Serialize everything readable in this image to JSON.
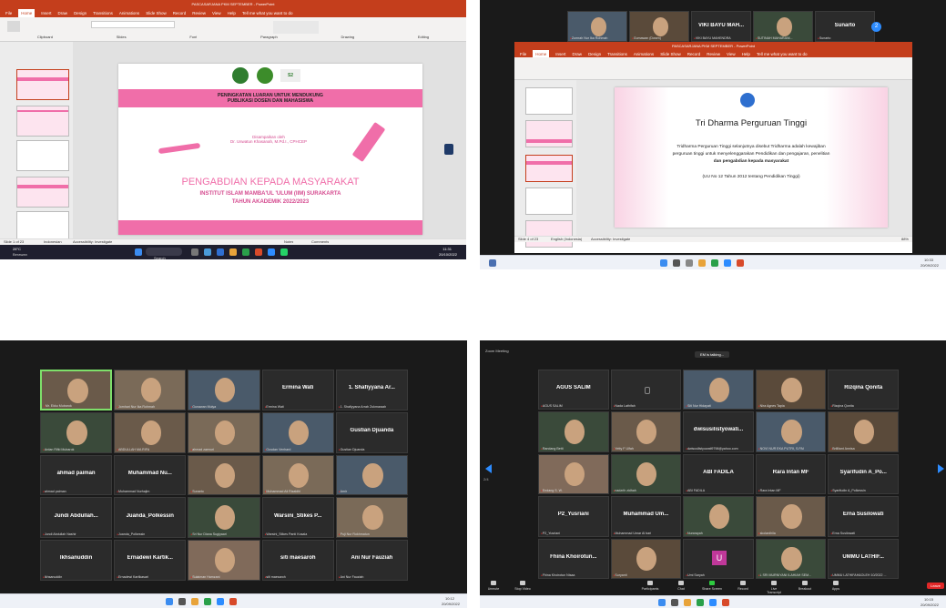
{
  "panel_tl": {
    "window_title": "PASCASARJANA PKM SEPTEMBER - PowerPoint",
    "account": "Tip Ari05 Oke",
    "tabs": [
      "File",
      "Home",
      "Insert",
      "Draw",
      "Design",
      "Transitions",
      "Animations",
      "Slide Show",
      "Record",
      "Review",
      "View",
      "Help"
    ],
    "tell_me": "Tell me what you want to do",
    "ribbon_groups": [
      "Clipboard",
      "Slides",
      "Font",
      "Paragraph",
      "Drawing",
      "Editing"
    ],
    "slide": {
      "heading_lines": [
        "PENINGKATAN LUARAN UNTUK MENDUKUNG",
        "PUBLIKASI DOSEN DAN MAHASISWA"
      ],
      "presented_by": "Disampaikan oleh",
      "presenter": "Dr. Uswatun Khasanah, M.Pd.I., CPHCEP",
      "title": "PENGABDIAN KEPADA MASYARAKAT",
      "institute": "INSTITUT ISLAM MAMBA'UL 'ULUM (IIM) SURAKARTA",
      "year": "TAHUN AKADEMIK 2022/2023"
    },
    "status_left": "Slide 1 of 23",
    "status_lang": "Indonesian",
    "status_access": "Accessibility: Investigate",
    "status_notes": "Notes",
    "status_comments": "Comments",
    "weather_temp": "28°C",
    "weather_desc": "Berawan",
    "search": "Search",
    "clock_time": "11:31",
    "clock_date": "20/10/2022"
  },
  "panel_tr": {
    "zoom_strip": [
      {
        "label": "Zumrah Nur Ika Rohmah",
        "video": true
      },
      {
        "label": "Gumawan (Dosen)",
        "video": true
      },
      {
        "label": "VIKI BAYU MAHENDRA",
        "name": "VIKI BAYU MAH...",
        "video": false
      },
      {
        "label": "SUTINAH MAHARANI...",
        "video": true
      },
      {
        "label": "Sunarto",
        "name": "Sunarto",
        "video": false
      }
    ],
    "next_page": "2",
    "window_title": "PASCASARJANA PKM SEPTEMBER - PowerPoint",
    "slide": {
      "title": "Tri Dharma Perguruan Tinggi",
      "body_lines": [
        "Tridharma Perguruan Tinggi selanjutnya disebut  Tridharma adalah kewajiban",
        "perguruan tinggi untuk menyelenggarakan Pendidikan dan pengajaran, penelitian",
        "dan  pengabdian kepada masyarakat"
      ],
      "citation": "(UU No 12 Tahun 2012 tentang Pendidikan Tinggi)"
    },
    "status_left": "Slide 4 of 23",
    "status_lang": "English (Indonesia)",
    "status_access": "Accessibility: Investigate",
    "zoom_pct": "88%",
    "clock_time": "10:33",
    "clock_date": "20/09/2022"
  },
  "panel_bl": {
    "tiles": [
      {
        "label": "Mr. Ekku Mubarok",
        "video": true,
        "highlight": true
      },
      {
        "label": "Jomhari Nur Ika Rohmah",
        "video": true
      },
      {
        "label": "Gunawan Mulya",
        "video": true
      },
      {
        "label": "Ermina Wati",
        "name": "Ermina Wati",
        "video": false
      },
      {
        "label": "1. Shafiyyana Arrab Zukmaraah",
        "name": "1. Shafiyyana Ar...",
        "video": false
      },
      {
        "label": "Ardan Rifki Mubarok",
        "video": true
      },
      {
        "label": "ABDULLAH MA RIFA",
        "video": true
      },
      {
        "label": "ahmad zaenuri",
        "video": true
      },
      {
        "label": "Gusdan Venhard",
        "video": true
      },
      {
        "label": "Gustian Djuanda",
        "name": "Gustian Djuanda",
        "video": false
      },
      {
        "label": "ahmad paiman",
        "name": "ahmad paiman",
        "video": false
      },
      {
        "label": "Muhammad Nurhajim",
        "name": "Muhammad  Nu...",
        "video": false
      },
      {
        "label": "Sunarto",
        "video": true
      },
      {
        "label": "Muhammad Ali Rizaldhi",
        "video": true
      },
      {
        "label": "Amir",
        "video": true
      },
      {
        "label": "Jundi Abdullah Nashir",
        "name": "Jundi  Abdullah...",
        "video": false
      },
      {
        "label": "Juanda_Polkessin",
        "name": "Juanda_Polkessin",
        "video": false
      },
      {
        "label": "Sri Nur Diana Sugiyaari",
        "video": true
      },
      {
        "label": "Warsini_Stikes Panti Kosala",
        "name": "Warsini_Stikes  P...",
        "video": false
      },
      {
        "label": "Puji Nur Rokhmatun",
        "video": true
      },
      {
        "label": "Ikhsanuddin",
        "name": "Ikhsanuddin",
        "video": false
      },
      {
        "label": "Ernadewi Kartikasari",
        "name": "Ernadewi  Kartik...",
        "video": false
      },
      {
        "label": "Sulaiman Hamzani",
        "video": true
      },
      {
        "label": "siti maesaroh",
        "name": "siti maesaroh",
        "video": false
      },
      {
        "label": "Ani Nur Fauziah",
        "name": "Ani Nur Fauziah",
        "video": false
      }
    ],
    "clock_time": "10:12",
    "clock_date": "20/09/2022"
  },
  "panel_br": {
    "window_title": "Zoom Meeting",
    "talking": "EM is talking...",
    "tiles": [
      {
        "label": "AGUS SALIM",
        "name": "AGUS SALIM",
        "video": false
      },
      {
        "label": "Nada Lathifah",
        "video": false
      },
      {
        "label": "Siti Nur Hidayati",
        "video": true
      },
      {
        "label": "Nira Agnes Tapia",
        "video": true
      },
      {
        "label": "Rizqina Qonita",
        "name": "Rizqina Qonita",
        "video": false
      },
      {
        "label": "Randang Betti",
        "video": true
      },
      {
        "label": "Yetty F Ulfah",
        "video": true
      },
      {
        "label": "dwisusilistyowati9798@yahoo.com",
        "name": "dwisusilistyowati...",
        "video": false
      },
      {
        "label": "NOVI NUR EKA PUTRI, S.PAI",
        "video": true
      },
      {
        "label": "Brillliant Annisa",
        "video": true
      },
      {
        "label": "Endang S. W.",
        "video": true
      },
      {
        "label": "nadzrih zidhah",
        "video": true
      },
      {
        "label": "ABI FADILA",
        "name": "ABI FADILA",
        "video": false
      },
      {
        "label": "Rara Intan MF",
        "name": "Rara Intan MF",
        "video": false
      },
      {
        "label": "Syarifudin A_Polkessin",
        "name": "Syarifudin A_Po...",
        "video": false
      },
      {
        "label": "P2_Yusriani",
        "name": "P2_Yusriani",
        "video": false
      },
      {
        "label": "Muhammad Umar Al bari",
        "name": "Muhammad  Um...",
        "video": false
      },
      {
        "label": "Nurarayah",
        "video": true
      },
      {
        "label": "skolardhila",
        "video": true
      },
      {
        "label": "Erna Susilowati",
        "name": "Erna Susilowati",
        "video": false
      },
      {
        "label": "Fhina Khoirotun Nisaa",
        "name": "Fhina  Khoirotun...",
        "video": false
      },
      {
        "label": "Suryanti",
        "video": true
      },
      {
        "label": "Umi Saryah",
        "avatar": "U",
        "video": false
      },
      {
        "label": "L SRI MURNIYANI ILAHIAH SEM...",
        "video": true
      },
      {
        "label": "UMMU LATHIFAH&OLEH 10/2022 ...",
        "name": "UMMU  LATHIF...",
        "video": false
      }
    ],
    "controls": [
      "Unmute",
      "Stop Video",
      "Participants",
      "Chat",
      "Share Screen",
      "Record",
      "Live Transcript",
      "Breakout",
      "Apps"
    ],
    "participants_count": "75",
    "leave": "Leave",
    "page_num": "2/4",
    "clock_time": "10:15",
    "clock_date": "20/09/2022"
  },
  "colors": {
    "pp_red": "#c43e1c",
    "pink": "#f06ea9",
    "zoom_dark": "#1a1a1a",
    "tile": "#2b2b2b",
    "highlight": "#7ee06a",
    "leave": "#e02828"
  }
}
